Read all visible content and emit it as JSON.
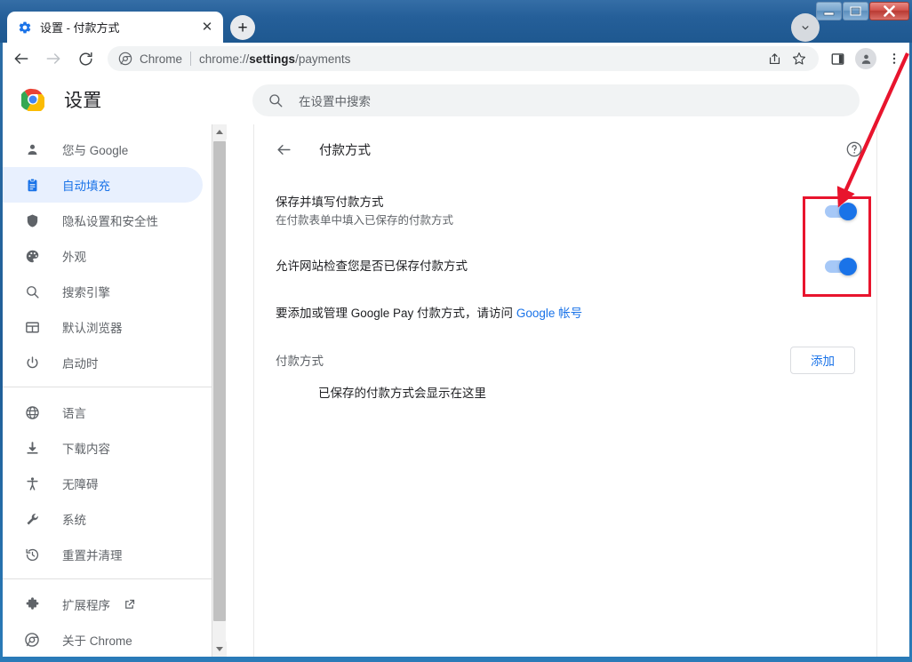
{
  "window": {
    "controls": [
      {
        "name": "minimize",
        "glyph": "—"
      },
      {
        "name": "maximize",
        "glyph": "❐"
      },
      {
        "name": "close",
        "glyph": "✕"
      }
    ]
  },
  "tabstrip": {
    "tab": {
      "title": "设置 - 付款方式",
      "favicon": "settings-gear-icon",
      "close_glyph": "✕"
    },
    "new_tab_glyph": "+",
    "new_tab_name": "new-tab-button",
    "tab_search_name": "tab-search-button",
    "tab_search_glyph": "⌄"
  },
  "toolbar": {
    "back_name": "back-button",
    "forward_name": "forward-button",
    "reload_name": "reload-button",
    "omnibox": {
      "chip_label": "Chrome",
      "url_prefix": "chrome://",
      "url_bold": "settings",
      "url_suffix": "/payments",
      "full_url": "chrome://settings/payments"
    },
    "icons": [
      {
        "name": "share-icon"
      },
      {
        "name": "bookmark-star-icon"
      },
      {
        "name": "side-panel-icon"
      },
      {
        "name": "profile-avatar-icon"
      },
      {
        "name": "three-dot-menu-icon"
      }
    ]
  },
  "settings": {
    "logo_name": "chrome-logo",
    "title": "设置",
    "search": {
      "placeholder": "在设置中搜索",
      "icon": "search-icon"
    }
  },
  "sidebar": {
    "groups": [
      {
        "items": [
          {
            "label": "您与 Google",
            "icon": "person-icon",
            "selected": false
          },
          {
            "label": "自动填充",
            "icon": "clipboard-icon",
            "selected": true
          },
          {
            "label": "隐私设置和安全性",
            "icon": "shield-icon",
            "selected": false
          },
          {
            "label": "外观",
            "icon": "palette-icon",
            "selected": false
          },
          {
            "label": "搜索引擎",
            "icon": "search-icon",
            "selected": false
          },
          {
            "label": "默认浏览器",
            "icon": "browser-window-icon",
            "selected": false
          },
          {
            "label": "启动时",
            "icon": "power-icon",
            "selected": false
          }
        ]
      },
      {
        "items": [
          {
            "label": "语言",
            "icon": "globe-icon",
            "selected": false
          },
          {
            "label": "下载内容",
            "icon": "download-icon",
            "selected": false
          },
          {
            "label": "无障碍",
            "icon": "accessibility-icon",
            "selected": false
          },
          {
            "label": "系统",
            "icon": "wrench-icon",
            "selected": false
          },
          {
            "label": "重置并清理",
            "icon": "restore-history-icon",
            "selected": false
          }
        ]
      },
      {
        "items": [
          {
            "label": "扩展程序",
            "icon": "puzzle-piece-icon",
            "selected": false,
            "external": true
          },
          {
            "label": "关于 Chrome",
            "icon": "chrome-outline-icon",
            "selected": false
          }
        ]
      }
    ]
  },
  "content": {
    "back_icon": "back-arrow-icon",
    "title": "付款方式",
    "help_icon": "help-circle-icon",
    "rows": [
      {
        "primary": "保存并填写付款方式",
        "secondary": "在付款表单中填入已保存的付款方式",
        "toggle_on": true,
        "toggle_name": "save-and-fill-payment-methods-toggle"
      },
      {
        "primary": "允许网站检查您是否已保存付款方式",
        "secondary": "",
        "toggle_on": true,
        "toggle_name": "allow-sites-to-check-toggle"
      }
    ],
    "google_pay_note": {
      "text_before": "要添加或管理 Google Pay 付款方式，请访问 ",
      "link": "Google 帐号"
    },
    "payment_section": {
      "title": "付款方式",
      "add_button": "添加",
      "empty_text": "已保存的付款方式会显示在这里"
    }
  },
  "annotation": {
    "highlight_color": "#e8142d",
    "arrow_name": "red-annotation-arrow",
    "box_name": "red-annotation-box"
  }
}
